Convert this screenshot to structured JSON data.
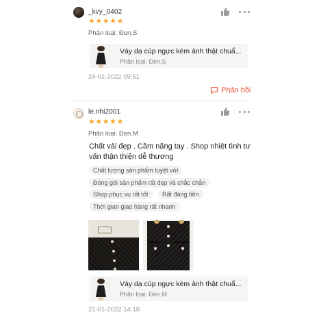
{
  "reviews": [
    {
      "username": "_kvy_0402",
      "stars": "★★★★★",
      "variant": "Phân loại: Đen,S",
      "product": {
        "name": "Váy dạ cúp ngực kèm ảnh thật chuẩ...",
        "variant": "Phân loại: Đen,S"
      },
      "timestamp": "24-01-2022 09:51",
      "reply_label": "Phản hồi"
    },
    {
      "username": "le.nhi2001",
      "stars": "★★★★★",
      "variant": "Phân loại: Đen,M",
      "comment": "Chất vải đẹp . Cầm nặng tay . Shop nhiệt tình tư vấn thận thiện dễ thương",
      "tags": [
        "Chất lượng sản phẩm tuyệt vời",
        "Đóng gói sản phẩm rất đẹp và chắc chắn",
        "Shop phục vụ rất tốt",
        "Rất đáng tiền",
        "Thời gian giao hàng rất nhanh"
      ],
      "product": {
        "name": "Váy dạ cúp ngực kèm ảnh thật chuẩ...",
        "variant": "Phân loại: Đen,M"
      },
      "timestamp": "21-01-2022 14:18"
    }
  ],
  "colors": {
    "accent": "#ee4d2d",
    "star": "#f5a623"
  },
  "icons": [
    "thumbs-up-icon",
    "more-options-icon",
    "reply-chat-icon"
  ]
}
